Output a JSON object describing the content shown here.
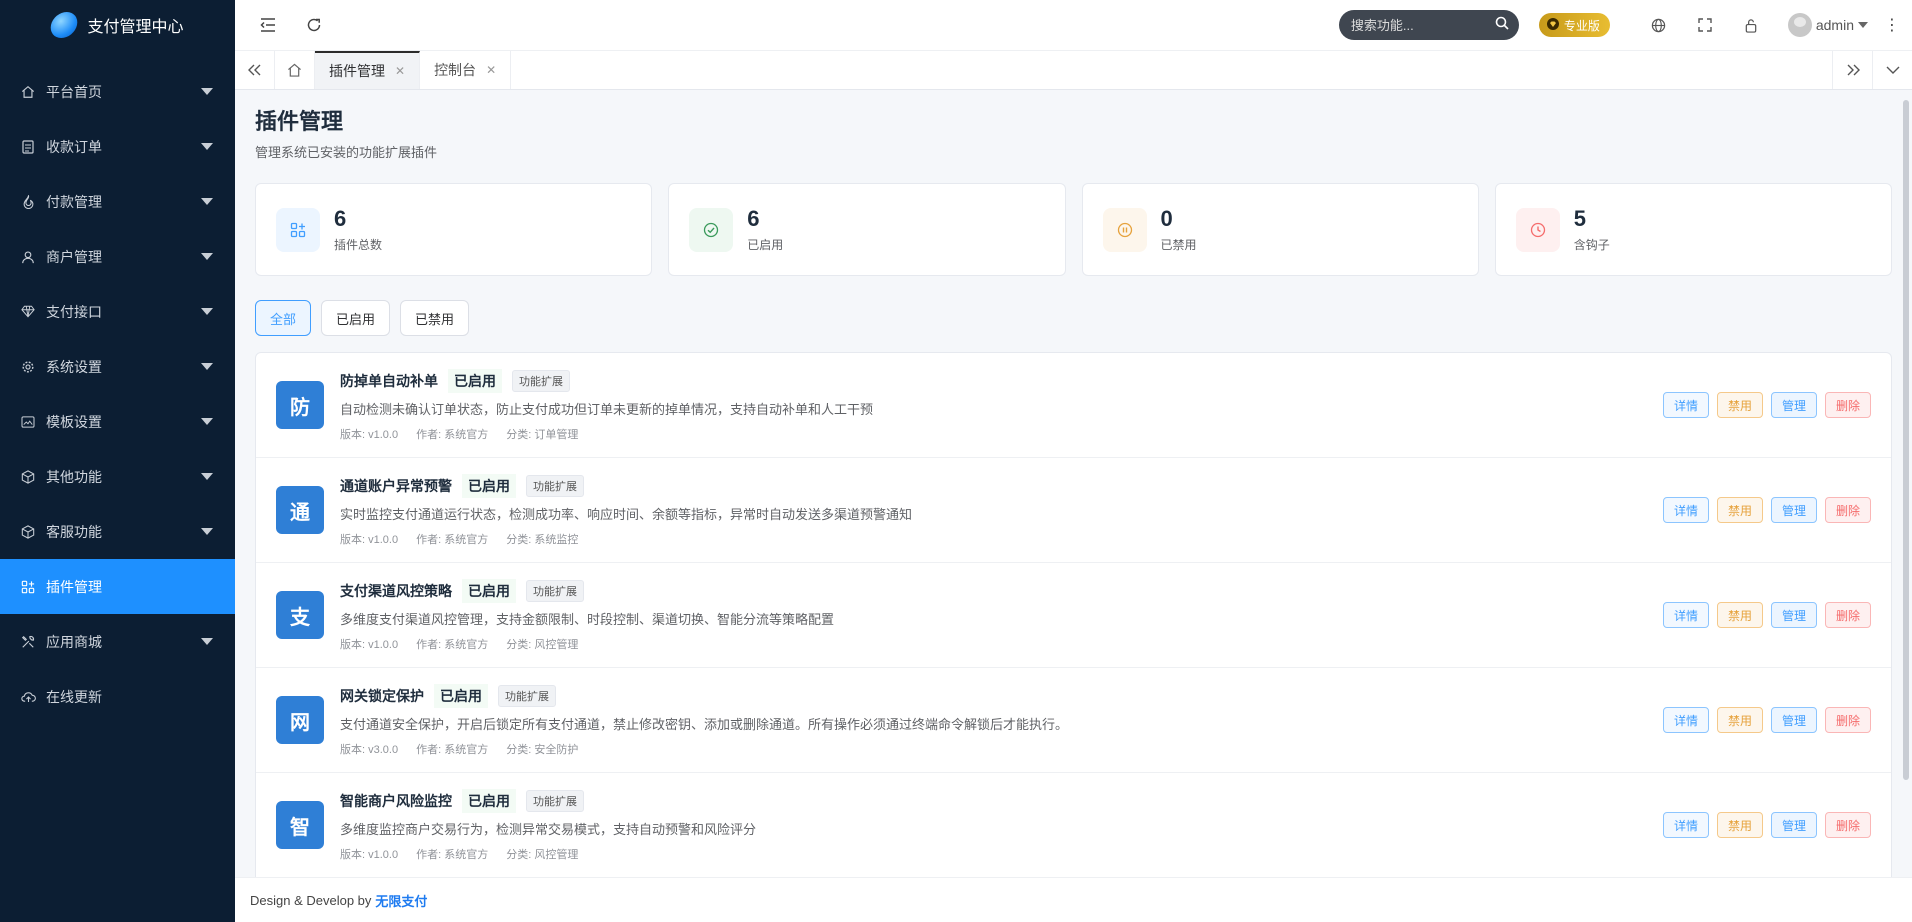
{
  "app": {
    "title": "支付管理中心"
  },
  "sidebar": {
    "items": [
      {
        "label": "平台首页",
        "icon": "home-icon",
        "active": false,
        "has_arrow": true
      },
      {
        "label": "收款订单",
        "icon": "document-icon",
        "active": false,
        "has_arrow": true
      },
      {
        "label": "付款管理",
        "icon": "flame-icon",
        "active": false,
        "has_arrow": true
      },
      {
        "label": "商户管理",
        "icon": "user-icon",
        "active": false,
        "has_arrow": true
      },
      {
        "label": "支付接口",
        "icon": "diamond-icon",
        "active": false,
        "has_arrow": true
      },
      {
        "label": "系统设置",
        "icon": "gear-icon",
        "active": false,
        "has_arrow": true
      },
      {
        "label": "模板设置",
        "icon": "template-icon",
        "active": false,
        "has_arrow": true
      },
      {
        "label": "其他功能",
        "icon": "cube-icon",
        "active": false,
        "has_arrow": true
      },
      {
        "label": "客服功能",
        "icon": "cube-icon",
        "active": false,
        "has_arrow": true
      },
      {
        "label": "插件管理",
        "icon": "plugin-icon",
        "active": true,
        "has_arrow": false
      },
      {
        "label": "应用商城",
        "icon": "tools-icon",
        "active": false,
        "has_arrow": true
      },
      {
        "label": "在线更新",
        "icon": "cloud-icon",
        "active": false,
        "has_arrow": false
      }
    ]
  },
  "topbar": {
    "search_placeholder": "搜索功能...",
    "pro_badge": "专业版",
    "username": "admin"
  },
  "tabs": [
    {
      "label": "插件管理",
      "active": true
    },
    {
      "label": "控制台",
      "active": false
    }
  ],
  "page": {
    "title": "插件管理",
    "subtitle": "管理系统已安装的功能扩展插件"
  },
  "stats": [
    {
      "value": "6",
      "label": "插件总数",
      "icon": "grid-plus-icon",
      "color": "#409eff",
      "bg": "#ecf5ff"
    },
    {
      "value": "6",
      "label": "已启用",
      "icon": "check-circle-icon",
      "color": "#3a9a5b",
      "bg": "#eef8f1"
    },
    {
      "value": "0",
      "label": "已禁用",
      "icon": "pause-circle-icon",
      "color": "#e6a23c",
      "bg": "#fdf6ec"
    },
    {
      "value": "5",
      "label": "含钩子",
      "icon": "clock-icon",
      "color": "#f56c6c",
      "bg": "#fef0f0"
    }
  ],
  "filters": [
    {
      "label": "全部",
      "active": true
    },
    {
      "label": "已启用",
      "active": false
    },
    {
      "label": "已禁用",
      "active": false
    }
  ],
  "actions": {
    "detail": "详情",
    "disable": "禁用",
    "manage": "管理",
    "delete": "删除"
  },
  "plugins": [
    {
      "initial": "防",
      "name": "防掉单自动补单",
      "status": "已启用",
      "tag": "功能扩展",
      "desc": "自动检测未确认订单状态，防止支付成功但订单未更新的掉单情况，支持自动补单和人工干预",
      "version": "版本: v1.0.0",
      "author": "作者: 系统官方",
      "category": "分类: 订单管理"
    },
    {
      "initial": "通",
      "name": "通道账户异常预警",
      "status": "已启用",
      "tag": "功能扩展",
      "desc": "实时监控支付通道运行状态，检测成功率、响应时间、余额等指标，异常时自动发送多渠道预警通知",
      "version": "版本: v1.0.0",
      "author": "作者: 系统官方",
      "category": "分类: 系统监控"
    },
    {
      "initial": "支",
      "name": "支付渠道风控策略",
      "status": "已启用",
      "tag": "功能扩展",
      "desc": "多维度支付渠道风控管理，支持金额限制、时段控制、渠道切换、智能分流等策略配置",
      "version": "版本: v1.0.0",
      "author": "作者: 系统官方",
      "category": "分类: 风控管理"
    },
    {
      "initial": "网",
      "name": "网关锁定保护",
      "status": "已启用",
      "tag": "功能扩展",
      "desc": "支付通道安全保护，开启后锁定所有支付通道，禁止修改密钥、添加或删除通道。所有操作必须通过终端命令解锁后才能执行。",
      "version": "版本: v3.0.0",
      "author": "作者: 系统官方",
      "category": "分类: 安全防护"
    },
    {
      "initial": "智",
      "name": "智能商户风险监控",
      "status": "已启用",
      "tag": "功能扩展",
      "desc": "多维度监控商户交易行为，检测异常交易模式，支持自动预警和风险评分",
      "version": "版本: v1.0.0",
      "author": "作者: 系统官方",
      "category": "分类: 风控管理"
    }
  ],
  "footer": {
    "text": "Design & Develop by",
    "brand": "无限支付"
  }
}
